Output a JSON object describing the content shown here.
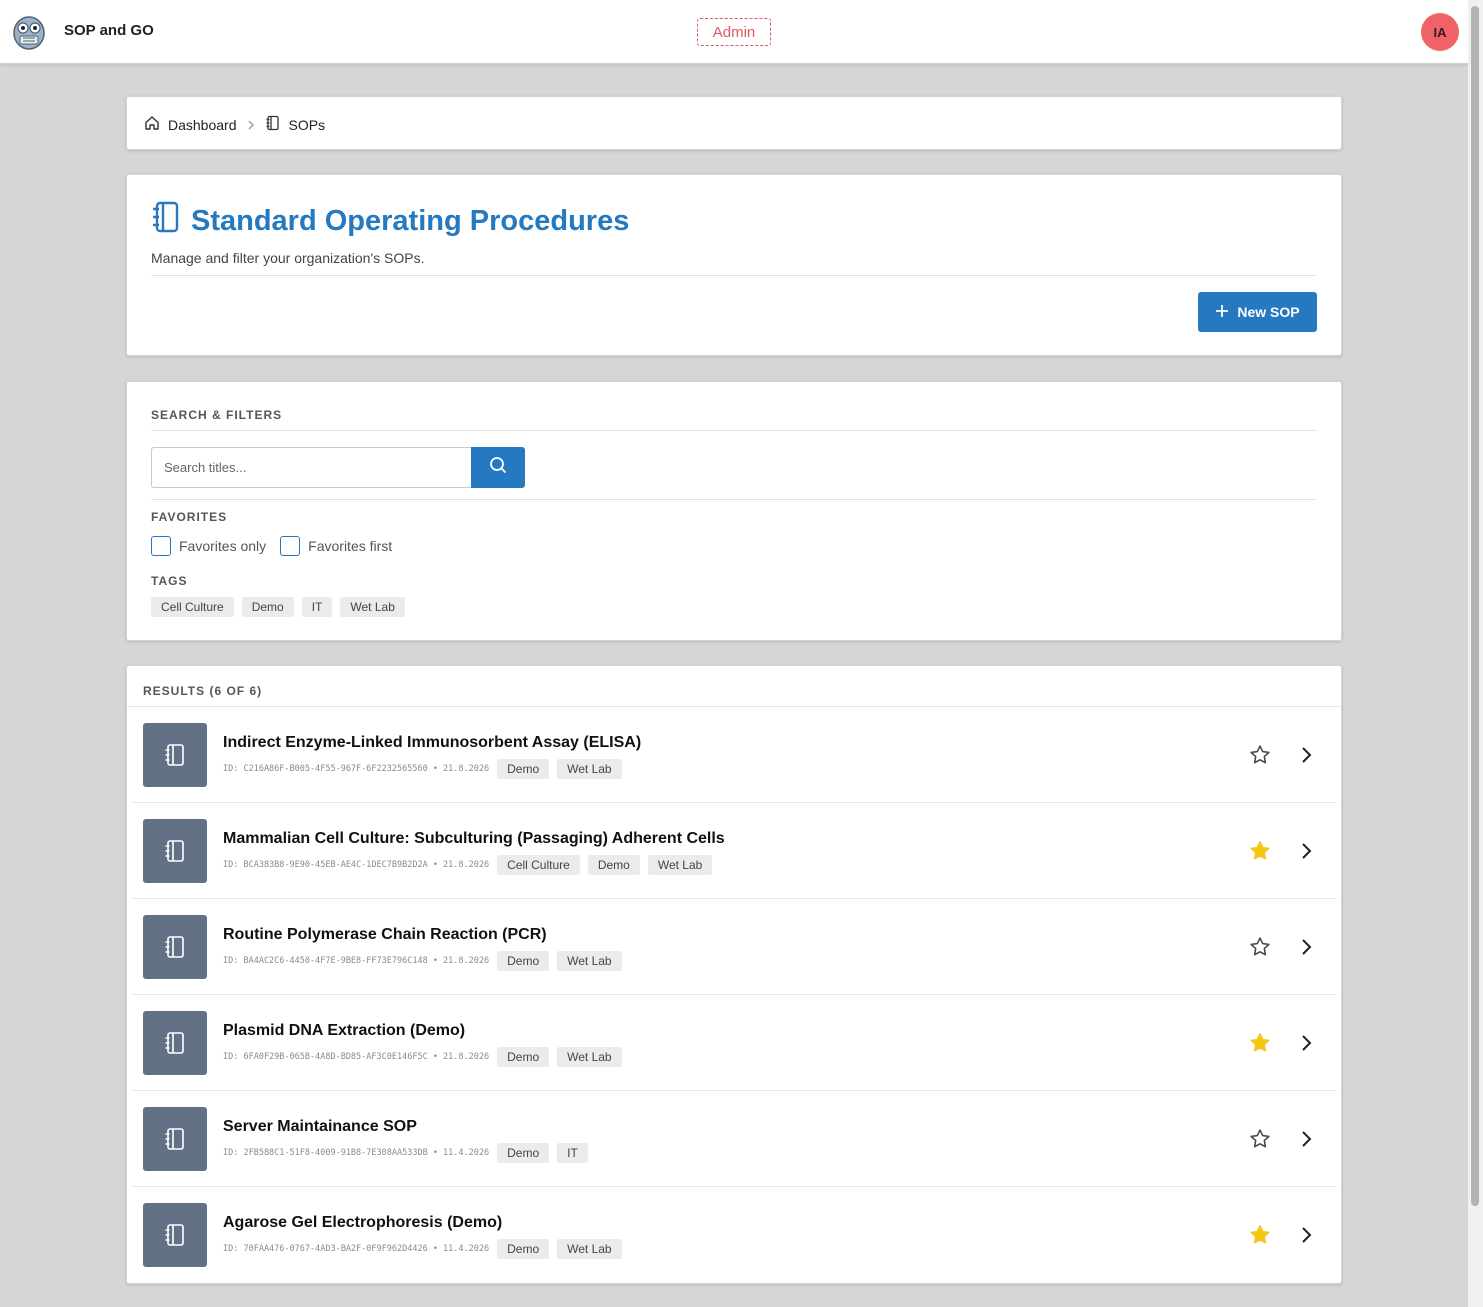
{
  "app": {
    "title": "SOP and GO",
    "role_badge": "Admin",
    "avatar_initials": "IA"
  },
  "breadcrumb": {
    "home": "Dashboard",
    "current": "SOPs"
  },
  "header": {
    "title": "Standard Operating Procedures",
    "subtitle": "Manage and filter your organization's SOPs.",
    "new_button": "New SOP"
  },
  "filters": {
    "section_label": "SEARCH & FILTERS",
    "search_placeholder": "Search titles...",
    "search_value": "",
    "favorites_label": "FAVORITES",
    "favorites_only": "Favorites only",
    "favorites_first": "Favorites first",
    "tags_label": "TAGS",
    "tags": [
      "Cell Culture",
      "Demo",
      "IT",
      "Wet Lab"
    ]
  },
  "results": {
    "label": "RESULTS (6 OF 6)",
    "items": [
      {
        "title": "Indirect Enzyme-Linked Immunosorbent Assay (ELISA)",
        "meta": "ID: C216A86F-B005-4F55-967F-6F2232565560 • 21.8.2026",
        "tags": [
          "Demo",
          "Wet Lab"
        ],
        "favorite": false
      },
      {
        "title": "Mammalian Cell Culture: Subculturing (Passaging) Adherent Cells",
        "meta": "ID: BCA383B8-9E90-45EB-AE4C-1DEC7B9B2D2A • 21.8.2026",
        "tags": [
          "Cell Culture",
          "Demo",
          "Wet Lab"
        ],
        "favorite": true
      },
      {
        "title": "Routine Polymerase Chain Reaction (PCR)",
        "meta": "ID: BA4AC2C6-4450-4F7E-9BE8-FF73E796C148 • 21.8.2026",
        "tags": [
          "Demo",
          "Wet Lab"
        ],
        "favorite": false
      },
      {
        "title": "Plasmid DNA Extraction (Demo)",
        "meta": "ID: 6FA0F29B-065B-4A8D-BD85-AF3C0E146F5C • 21.8.2026",
        "tags": [
          "Demo",
          "Wet Lab"
        ],
        "favorite": true
      },
      {
        "title": "Server Maintainance SOP",
        "meta": "ID: 2FB588C1-51F8-4009-91B8-7E308AA533DB • 11.4.2026",
        "tags": [
          "Demo",
          "IT"
        ],
        "favorite": false
      },
      {
        "title": "Agarose Gel Electrophoresis (Demo)",
        "meta": "ID: 70FAA476-0767-4AD3-BA2F-0F9F962D4426 • 11.4.2026",
        "tags": [
          "Demo",
          "Wet Lab"
        ],
        "favorite": true
      }
    ]
  },
  "colors": {
    "primary": "#2479c0",
    "admin": "#e0585f",
    "avatar": "#f0626a",
    "thumb": "#627185",
    "star_on": "#f5c518"
  },
  "icons": {
    "home": "home-icon",
    "notebook": "notebook-icon",
    "plus": "plus-icon",
    "search": "search-icon",
    "star": "star-icon",
    "chevron": "chevron-right-icon"
  }
}
